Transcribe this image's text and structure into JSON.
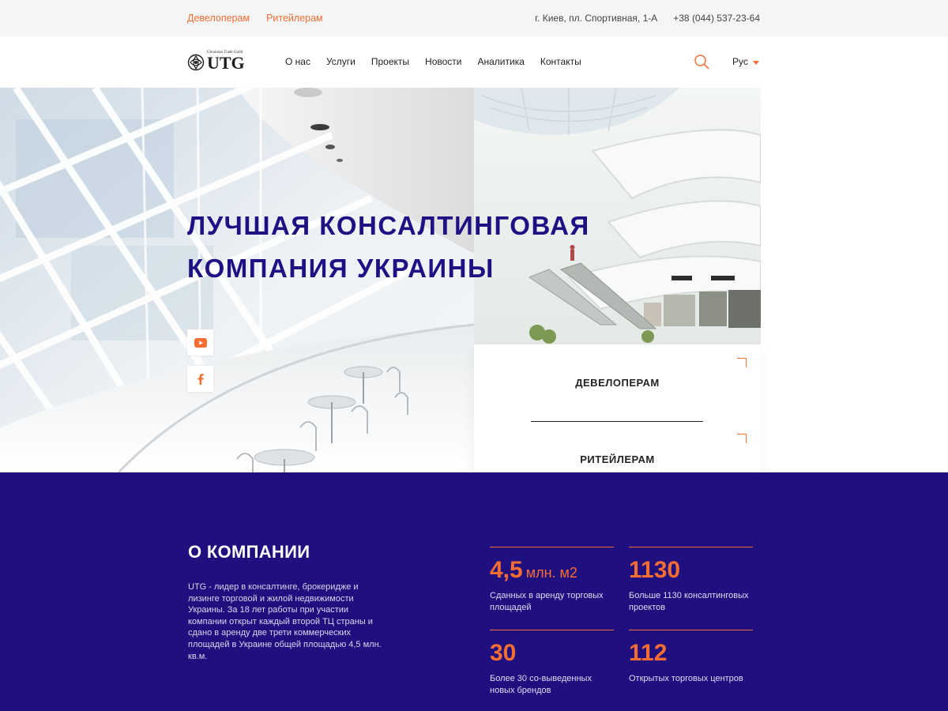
{
  "topbar": {
    "developers_link": "Девелоперам",
    "retailers_link": "Ритейлерам",
    "address": "г. Киев, пл. Спортивная, 1-А",
    "phone": "+38 (044) 537-23-64"
  },
  "header": {
    "logo_text": "UTG",
    "logo_subtext": "Ukrainian Trade Guild",
    "nav": [
      "О нас",
      "Услуги",
      "Проекты",
      "Новости",
      "Аналитика",
      "Контакты"
    ],
    "search_icon": "search-icon",
    "language": "Рус"
  },
  "hero": {
    "title_line1": "ЛУЧШАЯ КОНСАЛТИНГОВАЯ",
    "title_line2": "КОМПАНИЯ УКРАИНЫ",
    "social": [
      "youtube-icon",
      "facebook-icon"
    ]
  },
  "audience_card": {
    "developers": "ДЕВЕЛОПЕРАМ",
    "retailers": "РИТЕЙЛЕРАМ"
  },
  "about": {
    "title": "О КОМПАНИИ",
    "text": "UTG - лидер в консалтинге, брокеридже и лизинге торговой и жилой недвижимости Украины. За 18 лет работы при участии компании открыт каждый второй ТЦ страны и сдано в аренду две трети коммерческих площадей в Украине общей площадью 4,5 млн. кв.м.",
    "stats": [
      {
        "value": "4,5",
        "unit": "млн. м2",
        "label": "Сданных в аренду торговых площадей"
      },
      {
        "value": "1130",
        "unit": "",
        "label": "Больше 1130 консалтинговых проектов"
      },
      {
        "value": "30",
        "unit": "",
        "label": "Более 30 со-выведенных новых брендов"
      },
      {
        "value": "112",
        "unit": "",
        "label": "Открытых торговых центров"
      }
    ]
  },
  "colors": {
    "accent": "#f46d32",
    "brand_dark": "#20107f",
    "title_color": "#1f1184"
  }
}
